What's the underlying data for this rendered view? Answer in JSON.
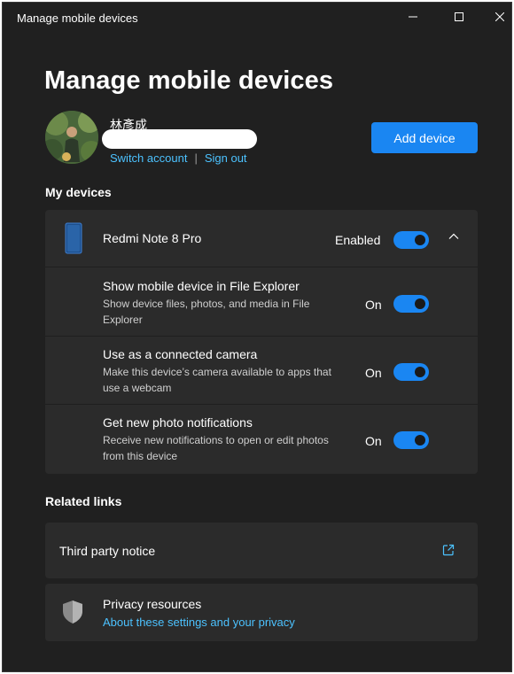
{
  "window": {
    "title": "Manage mobile devices"
  },
  "page": {
    "title": "Manage mobile devices"
  },
  "account": {
    "name": "林彥成",
    "switch_label": "Switch account",
    "separator": "|",
    "signout_label": "Sign out"
  },
  "actions": {
    "add_device_label": "Add device"
  },
  "my_devices": {
    "heading": "My devices",
    "device": {
      "name": "Redmi Note 8 Pro",
      "status_label": "Enabled",
      "enabled": true,
      "expanded": true,
      "settings": [
        {
          "title": "Show mobile device in File Explorer",
          "description": "Show device files, photos, and media in File Explorer",
          "state": "On",
          "on": true
        },
        {
          "title": "Use as a connected camera",
          "description": "Make this device’s camera available to apps that use a webcam",
          "state": "On",
          "on": true
        },
        {
          "title": "Get new photo notifications",
          "description": "Receive new notifications to open or edit photos from this device",
          "state": "On",
          "on": true
        }
      ]
    }
  },
  "related_links": {
    "heading": "Related links",
    "third_party": {
      "label": "Third party notice"
    },
    "privacy": {
      "title": "Privacy resources",
      "link": "About these settings and your privacy"
    }
  },
  "colors": {
    "background": "#202020",
    "card": "#2b2b2b",
    "accent": "#1a86f2",
    "link": "#4cc2ff"
  },
  "icons": [
    "minimize-icon",
    "maximize-icon",
    "close-icon",
    "phone-icon",
    "chevron-up-icon",
    "external-link-icon",
    "shield-icon"
  ]
}
